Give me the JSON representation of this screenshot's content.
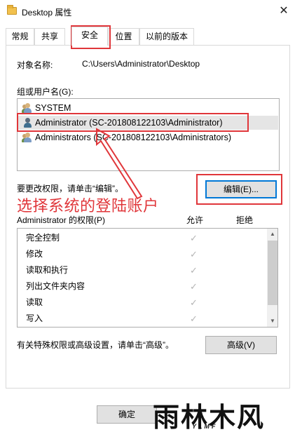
{
  "window": {
    "title": "Desktop 属性",
    "close_glyph": "✕"
  },
  "tabs": [
    {
      "label": "常规"
    },
    {
      "label": "共享"
    },
    {
      "label": "安全"
    },
    {
      "label": "位置"
    },
    {
      "label": "以前的版本"
    }
  ],
  "security": {
    "object_name_label": "对象名称:",
    "object_name_value": "C:\\Users\\Administrator\\Desktop",
    "group_label": "组或用户名(G):",
    "users": [
      {
        "name": "SYSTEM",
        "icon": "user-group-icon"
      },
      {
        "name": "Administrator (SC-201808122103\\Administrator)",
        "icon": "user-icon"
      },
      {
        "name": "Administrators (SC-201808122103\\Administrators)",
        "icon": "user-group-icon"
      }
    ],
    "change_hint": "要更改权限，请单击“编辑”。",
    "edit_button": "编辑(E)...",
    "annotation": "选择系统的登陆账户",
    "perm_header": "Administrator 的权限(P)",
    "allow_col": "允许",
    "deny_col": "拒绝",
    "permissions": [
      {
        "name": "完全控制",
        "allow": "✓",
        "deny": ""
      },
      {
        "name": "修改",
        "allow": "✓",
        "deny": ""
      },
      {
        "name": "读取和执行",
        "allow": "✓",
        "deny": ""
      },
      {
        "name": "列出文件夹内容",
        "allow": "✓",
        "deny": ""
      },
      {
        "name": "读取",
        "allow": "✓",
        "deny": ""
      },
      {
        "name": "写入",
        "allow": "✓",
        "deny": ""
      }
    ],
    "advanced_hint": "有关特殊权限或高级设置，请单击“高级”。",
    "advanced_button": "高级(V)"
  },
  "footer": {
    "ok_button": "确定"
  },
  "watermark": {
    "text": "雨林木风",
    "sub": "YLMF"
  },
  "colors": {
    "annotation_red": "#e0363a",
    "selection_bg": "#e5e5e5",
    "accent_blue": "#0078d7"
  }
}
